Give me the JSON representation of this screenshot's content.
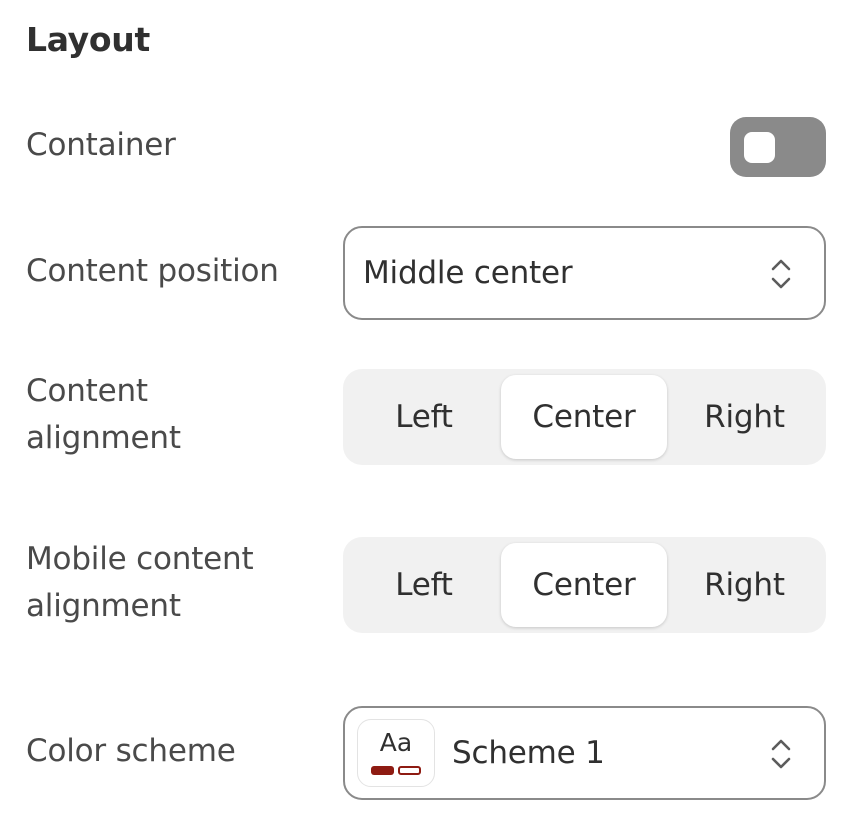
{
  "section": {
    "title": "Layout"
  },
  "container": {
    "label": "Container",
    "enabled": false
  },
  "content_position": {
    "label": "Content position",
    "value": "Middle center"
  },
  "content_alignment": {
    "label_line1": "Content",
    "label_line2": "alignment",
    "options": [
      "Left",
      "Center",
      "Right"
    ],
    "selected": "Center"
  },
  "mobile_content_alignment": {
    "label_line1": "Mobile content",
    "label_line2": "alignment",
    "options": [
      "Left",
      "Center",
      "Right"
    ],
    "selected": "Center"
  },
  "color_scheme": {
    "label": "Color scheme",
    "value": "Scheme 1",
    "swatch_text": "Aa",
    "swatch_primary": "#8e1b12",
    "swatch_secondary": "#8e1b12"
  },
  "colors": {
    "toggle_off": "#8a8a8a",
    "segment_track": "#f1f1f1",
    "text": "#303030"
  }
}
